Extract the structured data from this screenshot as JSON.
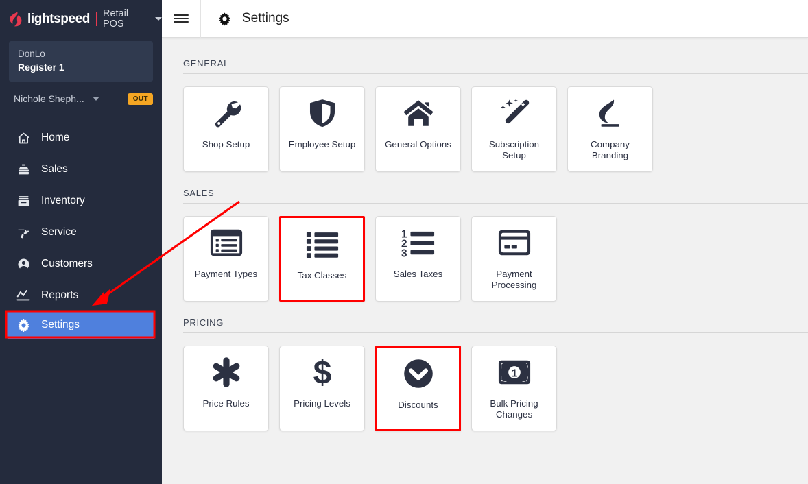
{
  "brand": {
    "logo_icon": "lightspeed-flame-icon",
    "word": "lightspeed",
    "product": "Retail POS",
    "caret_icon": "chevron-down-icon"
  },
  "sidebar": {
    "register": {
      "shop": "DonLo",
      "name": "Register 1"
    },
    "user": {
      "name": "Nichole Sheph...",
      "caret_icon": "chevron-down-icon",
      "status_badge": "OUT"
    },
    "items": [
      {
        "label": "Home",
        "icon": "home-icon",
        "active": false
      },
      {
        "label": "Sales",
        "icon": "cash-register-icon",
        "active": false
      },
      {
        "label": "Inventory",
        "icon": "inventory-box-icon",
        "active": false
      },
      {
        "label": "Service",
        "icon": "hammer-icon",
        "active": false
      },
      {
        "label": "Customers",
        "icon": "user-circle-icon",
        "active": false
      },
      {
        "label": "Reports",
        "icon": "chart-line-icon",
        "active": false
      },
      {
        "label": "Settings",
        "icon": "gear-icon",
        "active": true
      }
    ]
  },
  "topbar": {
    "menu_icon": "hamburger-icon",
    "page_icon": "gear-icon",
    "title": "Settings"
  },
  "sections": [
    {
      "title": "GENERAL",
      "cards": [
        {
          "label": "Shop Setup",
          "icon": "wrench-icon",
          "highlighted": false
        },
        {
          "label": "Employee Setup",
          "icon": "shield-icon",
          "highlighted": false
        },
        {
          "label": "General Options",
          "icon": "home-icon",
          "highlighted": false
        },
        {
          "label": "Subscription Setup",
          "icon": "magic-wand-icon",
          "highlighted": false
        },
        {
          "label": "Company Branding",
          "icon": "flame-icon",
          "highlighted": false
        }
      ]
    },
    {
      "title": "SALES",
      "cards": [
        {
          "label": "Payment Types",
          "icon": "list-card-icon",
          "highlighted": false
        },
        {
          "label": "Tax Classes",
          "icon": "bullet-list-icon",
          "highlighted": true
        },
        {
          "label": "Sales Taxes",
          "icon": "numbered-list-icon",
          "highlighted": false
        },
        {
          "label": "Payment Processing",
          "icon": "credit-card-icon",
          "highlighted": false
        }
      ]
    },
    {
      "title": "PRICING",
      "cards": [
        {
          "label": "Price Rules",
          "icon": "asterisk-icon",
          "highlighted": false
        },
        {
          "label": "Pricing Levels",
          "icon": "dollar-sign-icon",
          "highlighted": false
        },
        {
          "label": "Discounts",
          "icon": "chevron-circle-down-icon",
          "highlighted": true
        },
        {
          "label": "Bulk Pricing Changes",
          "icon": "money-bill-icon",
          "highlighted": false
        }
      ]
    }
  ],
  "annotations": {
    "arrow_color": "#ff0000",
    "highlight_color": "#ff0000",
    "active_nav_color": "#4f80dd"
  }
}
